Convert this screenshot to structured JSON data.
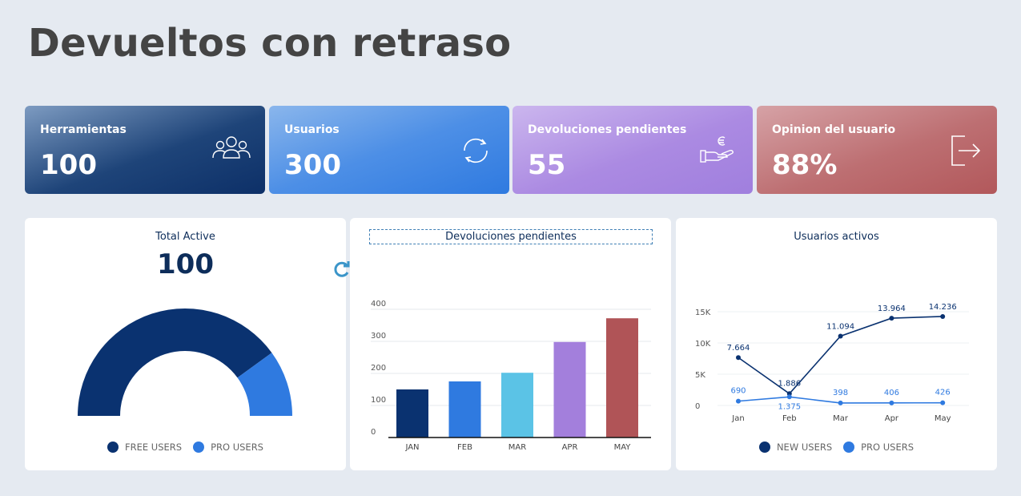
{
  "page": {
    "title": "Devueltos con retraso"
  },
  "kpis": [
    {
      "label": "Herramientas",
      "value": "100",
      "icon": "users-group-icon"
    },
    {
      "label": "Usuarios",
      "value": "300",
      "icon": "refresh-icon"
    },
    {
      "label": "Devoluciones pendientes",
      "value": "55",
      "icon": "hand-euro-icon"
    },
    {
      "label": "Opinion del usuario",
      "value": "88%",
      "icon": "logout-icon"
    }
  ],
  "gauge_card": {
    "title": "Total Active",
    "value": "100",
    "legend": [
      {
        "label": "FREE USERS",
        "color": "#0a3270"
      },
      {
        "label": "PRO USERS",
        "color": "#2f7ae0"
      }
    ]
  },
  "bar_card": {
    "title": "Devoluciones pendientes"
  },
  "line_card": {
    "title": "Usuarios activos",
    "legend": [
      {
        "label": "NEW USERS",
        "color": "#0a3270"
      },
      {
        "label": "PRO USERS",
        "color": "#2f7ae0"
      }
    ]
  },
  "chart_data": [
    {
      "type": "pie",
      "title": "Total Active",
      "categories": [
        "FREE USERS",
        "PRO USERS"
      ],
      "values": [
        80,
        20
      ],
      "colors": [
        "#0a3270",
        "#2f7ae0"
      ]
    },
    {
      "type": "bar",
      "title": "Devoluciones pendientes",
      "categories": [
        "JAN",
        "FEB",
        "MAR",
        "APR",
        "MAY"
      ],
      "values": [
        150,
        175,
        202,
        298,
        372
      ],
      "colors": [
        "#0a3270",
        "#2f7ae0",
        "#5bc3e6",
        "#a37fdc",
        "#b05457"
      ],
      "yticks": [
        "0",
        "100",
        "200",
        "300",
        "400"
      ],
      "ylim": [
        0,
        400
      ]
    },
    {
      "type": "line",
      "title": "Usuarios activos",
      "categories": [
        "Jan",
        "Feb",
        "Mar",
        "Apr",
        "May"
      ],
      "yticks": [
        "0",
        "5K",
        "10K",
        "15K"
      ],
      "ylim": [
        0,
        15000
      ],
      "series": [
        {
          "name": "NEW USERS",
          "color": "#0a3270",
          "values": [
            7664,
            1886,
            11094,
            13964,
            14236
          ],
          "labels": [
            "7.664",
            "1.886",
            "11.094",
            "13.964",
            "14.236"
          ]
        },
        {
          "name": "PRO USERS",
          "color": "#2f7ae0",
          "values": [
            690,
            1375,
            398,
            406,
            426
          ],
          "labels": [
            "690",
            "1.375",
            "398",
            "406",
            "426"
          ]
        }
      ]
    }
  ]
}
